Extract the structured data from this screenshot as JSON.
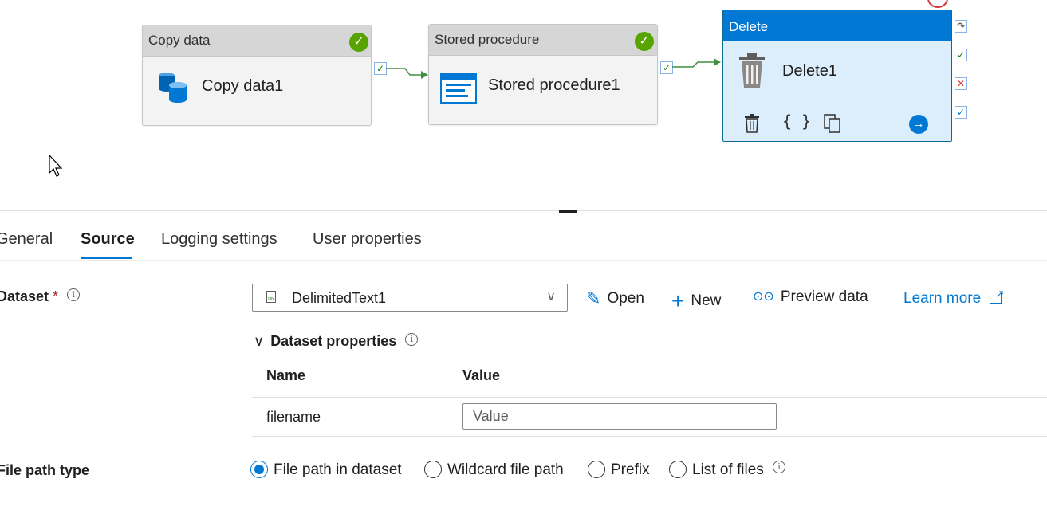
{
  "pipeline": {
    "activities": [
      {
        "type": "Copy data",
        "name": "Copy data1",
        "status": "succeeded"
      },
      {
        "type": "Stored procedure",
        "name": "Stored procedure1",
        "status": "succeeded"
      },
      {
        "type": "Delete",
        "name": "Delete1",
        "selected": true
      }
    ],
    "selected_toolbar": [
      "delete-icon",
      "code-braces-icon",
      "copy-icon",
      "arrow-right-circle-icon"
    ],
    "port_icons": [
      "check-icon",
      "skip-icon",
      "x-icon"
    ]
  },
  "tabs": [
    {
      "label": "General",
      "active": false
    },
    {
      "label": "Source",
      "active": true
    },
    {
      "label": "Logging settings",
      "active": false
    },
    {
      "label": "User properties",
      "active": false
    }
  ],
  "dataset": {
    "label": "Dataset",
    "required_mark": "*",
    "selected": "DelimitedText1",
    "actions": {
      "open": "Open",
      "new": "New",
      "preview": "Preview data"
    },
    "learn_more": "Learn more"
  },
  "dataset_properties": {
    "title": "Dataset properties",
    "columns": [
      "Name",
      "Value"
    ],
    "rows": [
      {
        "name": "filename",
        "value": "",
        "placeholder": "Value"
      }
    ]
  },
  "file_path_type": {
    "label": "File path type",
    "options": [
      {
        "label": "File path in dataset",
        "checked": true
      },
      {
        "label": "Wildcard file path",
        "checked": false
      },
      {
        "label": "Prefix",
        "checked": false
      },
      {
        "label": "List of files",
        "checked": false
      }
    ]
  },
  "colors": {
    "accent": "#0078d4",
    "success": "#57a300",
    "error": "#d13438",
    "selected_header": "#0078d4",
    "selected_body": "#dcedfb"
  }
}
